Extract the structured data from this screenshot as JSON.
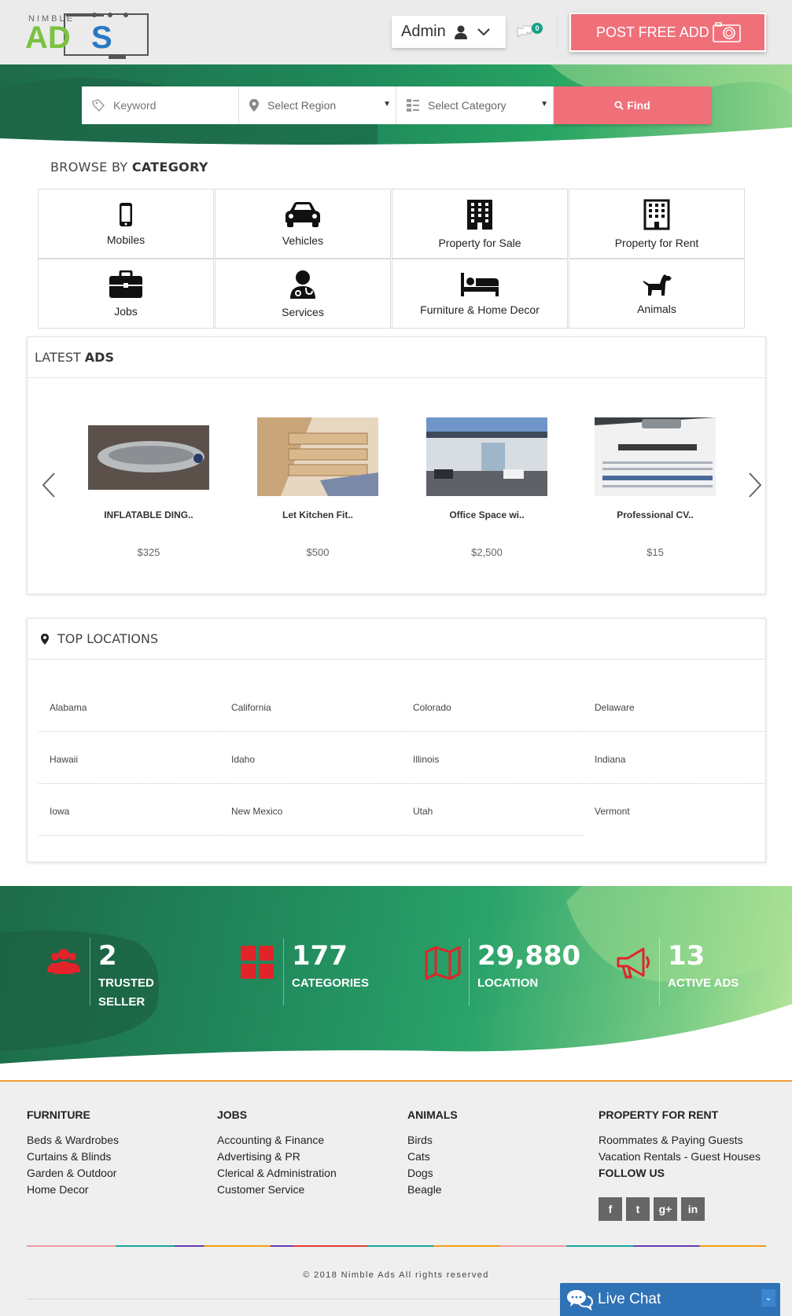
{
  "header": {
    "logo_text": "NIMBLE ADS",
    "user_label": "Admin",
    "chat_count": "0",
    "post_button": "POST FREE ADD"
  },
  "search": {
    "keyword_placeholder": "Keyword",
    "region_label": "Select Region",
    "category_label": "Select Category",
    "find_label": "Find"
  },
  "browse": {
    "title_prefix": "BROWSE BY",
    "title_strong": "CATEGORY",
    "categories": [
      {
        "label": "Mobiles",
        "icon": "mobile-phone-icon"
      },
      {
        "label": "Vehicles",
        "icon": "car-icon"
      },
      {
        "label": "Property for Sale",
        "icon": "building-icon"
      },
      {
        "label": "Property for Rent",
        "icon": "building-outline-icon"
      },
      {
        "label": "Jobs",
        "icon": "briefcase-icon"
      },
      {
        "label": "Services",
        "icon": "user-doctor-icon"
      },
      {
        "label": "Furniture & Home Decor",
        "icon": "bed-icon"
      },
      {
        "label": "Animals",
        "icon": "dog-icon"
      }
    ]
  },
  "latest": {
    "title_prefix": "LATEST",
    "title_strong": "ADS",
    "ads": [
      {
        "title": "INFLATABLE DING..",
        "price": "$325"
      },
      {
        "title": "Let Kitchen Fit..",
        "price": "$500"
      },
      {
        "title": "Office Space wi..",
        "price": "$2,500"
      },
      {
        "title": "Professional CV..",
        "price": "$15"
      }
    ]
  },
  "locations": {
    "title": "TOP LOCATIONS",
    "items": [
      "Alabama",
      "California",
      "Colorado",
      "Delaware",
      "Hawaii",
      "Idaho",
      "Illinois",
      "Indiana",
      "Iowa",
      "New Mexico",
      "Utah",
      "Vermont"
    ]
  },
  "stats": [
    {
      "value": "2",
      "label": "TRUSTED\nSELLER",
      "icon": "users-icon"
    },
    {
      "value": "177",
      "label": "CATEGORIES",
      "icon": "grid-icon"
    },
    {
      "value": "29,880",
      "label": "LOCATION",
      "icon": "map-icon"
    },
    {
      "value": "13",
      "label": "ACTIVE ADS",
      "icon": "megaphone-icon"
    }
  ],
  "footer": {
    "columns": [
      {
        "heading": "FURNITURE",
        "links": [
          "Beds & Wardrobes",
          "Curtains & Blinds",
          "Garden & Outdoor",
          "Home Decor"
        ]
      },
      {
        "heading": "JOBS",
        "links": [
          "Accounting & Finance",
          "Advertising & PR",
          "Clerical & Administration",
          "Customer Service"
        ]
      },
      {
        "heading": "ANIMALS",
        "links": [
          "Birds",
          "Cats",
          "Dogs",
          "Beagle"
        ]
      },
      {
        "heading": "PROPERTY FOR RENT",
        "links": [
          "Roommates & Paying Guests",
          "Vacation Rentals - Guest Houses"
        ]
      }
    ],
    "follow_us": "FOLLOW US",
    "social": [
      "f",
      "t",
      "g+",
      "in"
    ],
    "copyright": "© 2018 Nimble Ads All  rights reserved",
    "live_chat": "Live Chat"
  },
  "colors": {
    "accent": "#f0707a",
    "green_dark": "#1e6b4a",
    "green_light": "#8fd48a",
    "stat_icon_red": "#e0242a",
    "live_chat_blue": "#2f73b6"
  }
}
